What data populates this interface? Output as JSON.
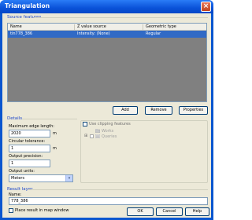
{
  "window": {
    "title": "Triangulation",
    "close_glyph": "×"
  },
  "source_features": {
    "group_label": "Source features",
    "columns": [
      "Name",
      "Z value source",
      "Geometric type"
    ],
    "rows": [
      {
        "name": "tin778_386",
        "z_source": "Intensity: (None)",
        "geom_type": "Regular"
      }
    ],
    "buttons": {
      "add": "Add",
      "remove": "Remove",
      "properties": "Properties"
    }
  },
  "details": {
    "group_label": "Details",
    "max_edge_length_label": "Maximum edge length:",
    "max_edge_length_value": "2020",
    "max_edge_length_unit": "m",
    "circular_tolerance_label": "Circular tolerance:",
    "circular_tolerance_value": "1",
    "circular_tolerance_unit": "m",
    "output_precision_label": "Output precision:",
    "output_precision_value": "1",
    "output_units_label": "Output units:",
    "output_units_value": "Meters"
  },
  "clipping": {
    "checkbox_label": "Use clipping features",
    "checked": false,
    "tree": [
      {
        "label": "Works",
        "expandable": false
      },
      {
        "label": "Queries",
        "expandable": true
      }
    ]
  },
  "result_layer": {
    "group_label": "Result layer",
    "name_label": "Name:",
    "name_value": "778_386",
    "place_in_map_label": "Place result in map window",
    "place_in_map_checked": false
  },
  "footer": {
    "ok": "OK",
    "cancel": "Cancel",
    "help": "Help"
  },
  "colors": {
    "titlebar": "#0a52d8",
    "client_bg": "#ece9d8",
    "group_label": "#1d46c8",
    "selection": "#316ac5"
  }
}
